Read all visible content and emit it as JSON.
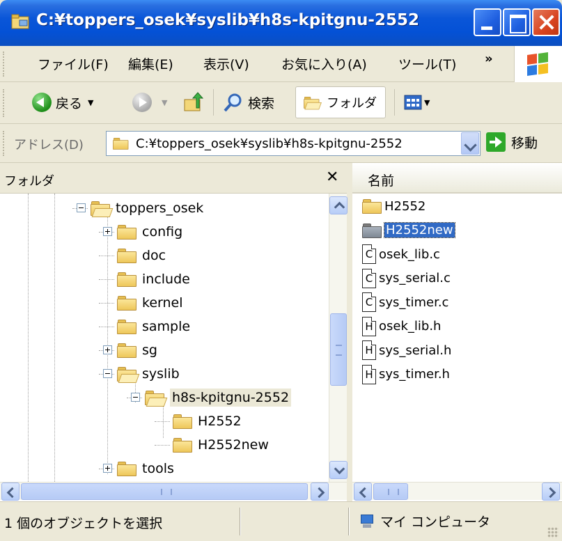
{
  "window": {
    "title": "C:¥toppers_osek¥syslib¥h8s-kpitgnu-2552"
  },
  "menu": [
    "ファイル(F)",
    "編集(E)",
    "表示(V)",
    "お気に入り(A)",
    "ツール(T)"
  ],
  "toolbar": {
    "back_label": "戻る",
    "search_label": "検索",
    "folders_label": "フォルダ"
  },
  "address": {
    "label": "アドレス(D)",
    "value": "C:¥toppers_osek¥syslib¥h8s-kpitgnu-2552",
    "go_label": "移動"
  },
  "folder_pane": {
    "title": "フォルダ",
    "tree": [
      {
        "label": "toppers_osek",
        "level": 0,
        "expander": "minus",
        "open": true
      },
      {
        "label": "config",
        "level": 1,
        "expander": "plus"
      },
      {
        "label": "doc",
        "level": 1,
        "expander": "none"
      },
      {
        "label": "include",
        "level": 1,
        "expander": "none"
      },
      {
        "label": "kernel",
        "level": 1,
        "expander": "none"
      },
      {
        "label": "sample",
        "level": 1,
        "expander": "none"
      },
      {
        "label": "sg",
        "level": 1,
        "expander": "plus"
      },
      {
        "label": "syslib",
        "level": 1,
        "expander": "minus",
        "open": true
      },
      {
        "label": "h8s-kpitgnu-2552",
        "level": 2,
        "expander": "minus",
        "open": true,
        "highlighted": true
      },
      {
        "label": "H2552",
        "level": 3,
        "expander": "none"
      },
      {
        "label": "H2552new",
        "level": 3,
        "expander": "none"
      },
      {
        "label": "tools",
        "level": 1,
        "expander": "plus"
      }
    ]
  },
  "content_pane": {
    "column_header": "名前",
    "items": [
      {
        "name": "H2552",
        "type": "folder"
      },
      {
        "name": "H2552new",
        "type": "folder",
        "selected": true
      },
      {
        "name": "osek_lib.c",
        "type": "c"
      },
      {
        "name": "sys_serial.c",
        "type": "c"
      },
      {
        "name": "sys_timer.c",
        "type": "c"
      },
      {
        "name": "osek_lib.h",
        "type": "h"
      },
      {
        "name": "sys_serial.h",
        "type": "h"
      },
      {
        "name": "sys_timer.h",
        "type": "h"
      }
    ]
  },
  "statusbar": {
    "selection_text": "1 個のオブジェクトを選択",
    "location_text": "マイ コンピュータ"
  }
}
